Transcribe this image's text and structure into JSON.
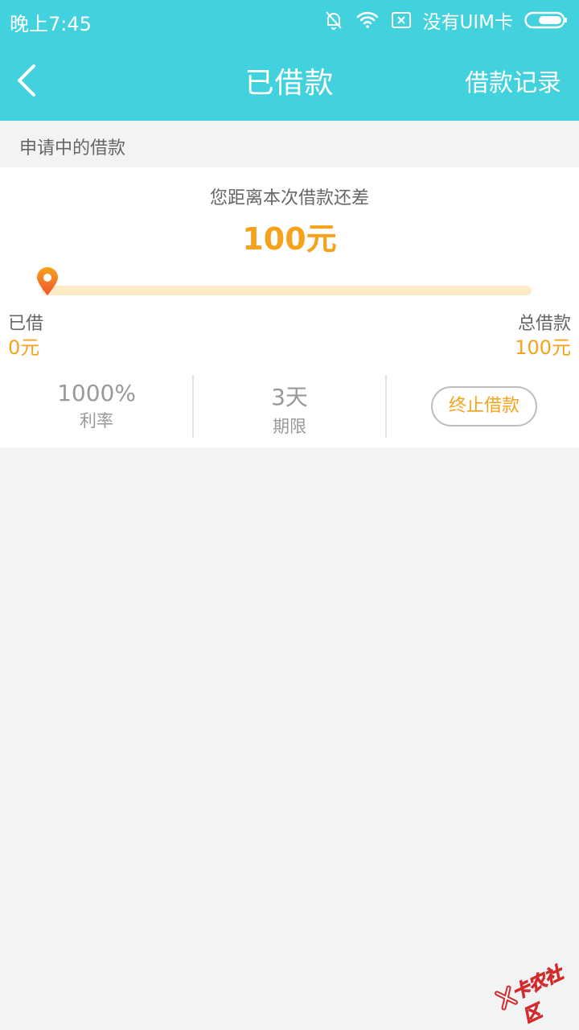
{
  "status_bar": {
    "time": "晚上7:45",
    "carrier": "没有UIM卡",
    "icons": [
      "bell-off-icon",
      "wifi-icon",
      "sim-error-icon",
      "battery-icon"
    ]
  },
  "nav": {
    "title": "已借款",
    "record_label": "借款记录",
    "back_icon": "back-chevron-icon"
  },
  "section": {
    "label": "申请中的借款"
  },
  "loan": {
    "tip": "您距离本次借款还差",
    "remaining": "100元",
    "borrowed_label": "已借",
    "borrowed_value": "0元",
    "total_label": "总借款",
    "total_value": "100元",
    "progress": 0
  },
  "stats": {
    "rate_value": "1000%",
    "rate_label": "利率",
    "term_value": "3天",
    "term_label": "期限",
    "stop_button": "终止借款"
  },
  "colors": {
    "header": "#42d2dd",
    "accent": "#f7a21b",
    "background": "#f2f3f5",
    "track": "#fdebc8"
  },
  "watermark": {
    "text": "卡农社区"
  }
}
